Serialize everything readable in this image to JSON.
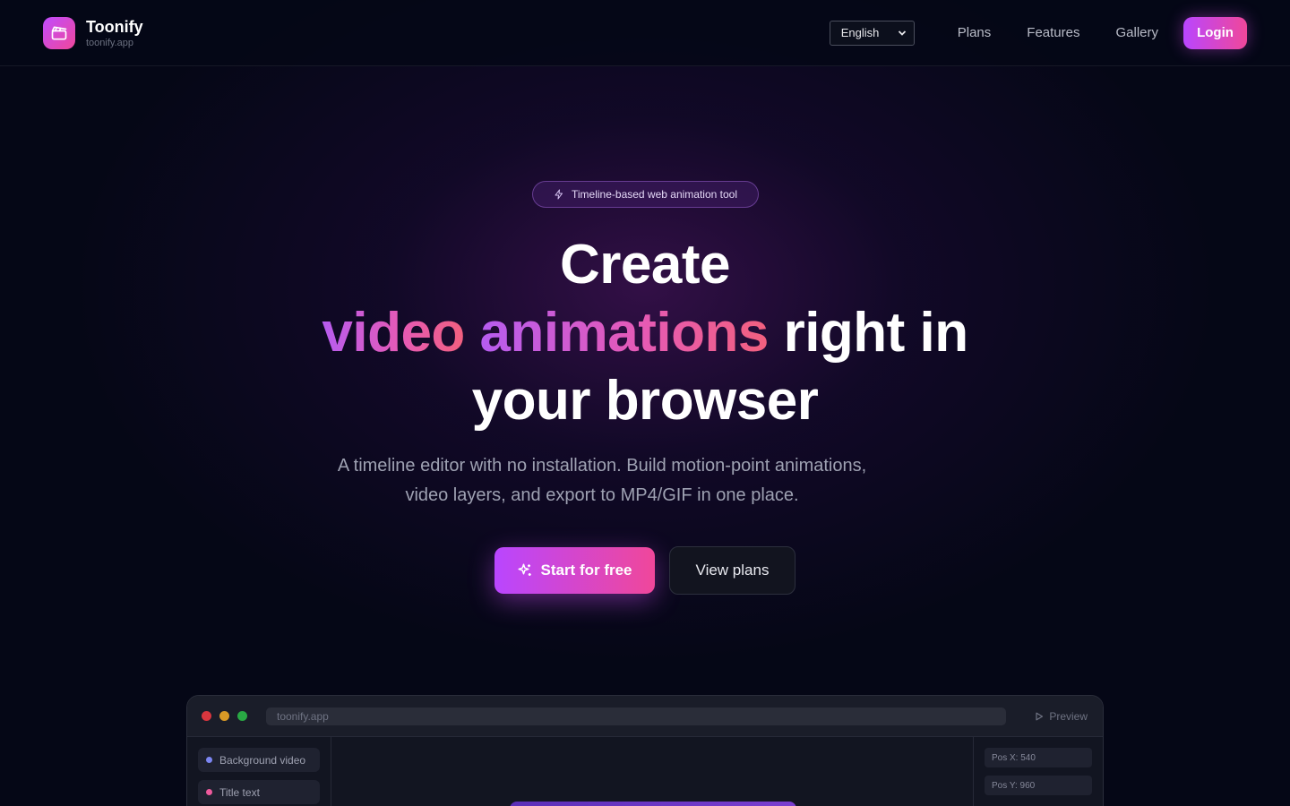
{
  "header": {
    "brand_name": "Toonify",
    "brand_domain": "toonify.app",
    "language_selected": "English",
    "nav": [
      "Plans",
      "Features",
      "Gallery"
    ],
    "login_label": "Login"
  },
  "hero": {
    "badge": "Timeline-based web animation tool",
    "headline_line1": "Create",
    "headline_grad1": "video",
    "headline_grad2": "animations",
    "headline_rest": "right in",
    "headline_line3": "your browser",
    "subtitle_line1": "A timeline editor with no installation. Build motion-point animations,",
    "subtitle_line2": "video layers, and export to MP4/GIF in one place.",
    "primary_cta": "Start for free",
    "secondary_cta": "View plans"
  },
  "editor": {
    "url": "toonify.app",
    "preview_label": "Preview",
    "layers": [
      {
        "label": "Background video",
        "color": "#7c86f2"
      },
      {
        "label": "Title text",
        "color": "#ee5a9c"
      }
    ],
    "properties": [
      "Pos X: 540",
      "Pos Y: 960"
    ]
  },
  "colors": {
    "accent_start": "#b946ff",
    "accent_end": "#f0479a",
    "background": "#050716",
    "traffic_red": "#d9363e",
    "traffic_yellow": "#d99a26",
    "traffic_green": "#29a844"
  },
  "icons": {
    "logo": "clapperboard-icon",
    "badge": "lightning-icon",
    "primary_cta": "sparkles-icon",
    "preview": "play-icon",
    "select": "chevron-down-icon"
  }
}
